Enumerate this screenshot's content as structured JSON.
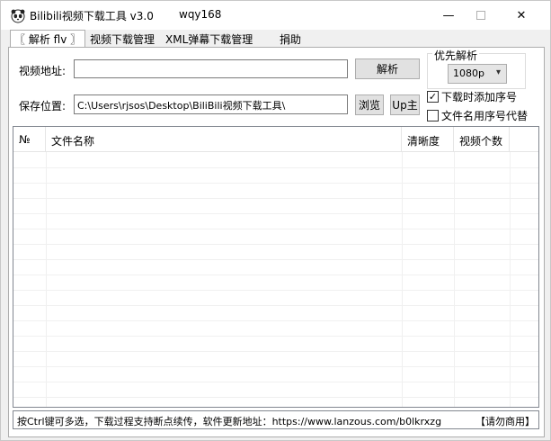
{
  "window": {
    "title": "Bilibili视频下载工具 v3.0",
    "title_extra": "wqy168",
    "minimize": "—",
    "close": "✕"
  },
  "tabs": [
    {
      "label": "〖 解析 flv 〗"
    },
    {
      "label": "视频下载管理"
    },
    {
      "label": "XML弹幕下载管理"
    },
    {
      "label": "捐助"
    }
  ],
  "form": {
    "url_label": "视频地址:",
    "url_value": "",
    "parse_button": "解析",
    "save_label": "保存位置:",
    "save_path": "C:\\Users\\rjsos\\Desktop\\BiliBili视频下载工具\\",
    "browse_button": "浏览",
    "up_button": "Up主"
  },
  "priority": {
    "title": "优先解析",
    "selected": "1080p"
  },
  "options": {
    "add_seq": {
      "label": "下载时添加序号",
      "checked": true
    },
    "name_by_seq": {
      "label": "文件名用序号代替",
      "checked": false
    }
  },
  "list": {
    "columns": [
      "№",
      "文件名称",
      "清晰度",
      "视频个数"
    ]
  },
  "status": {
    "text": "按Ctrl键可多选，下载过程支持断点续传，软件更新地址：https://www.lanzous.com/b0lkrxzg",
    "right": "【请勿商用】"
  }
}
